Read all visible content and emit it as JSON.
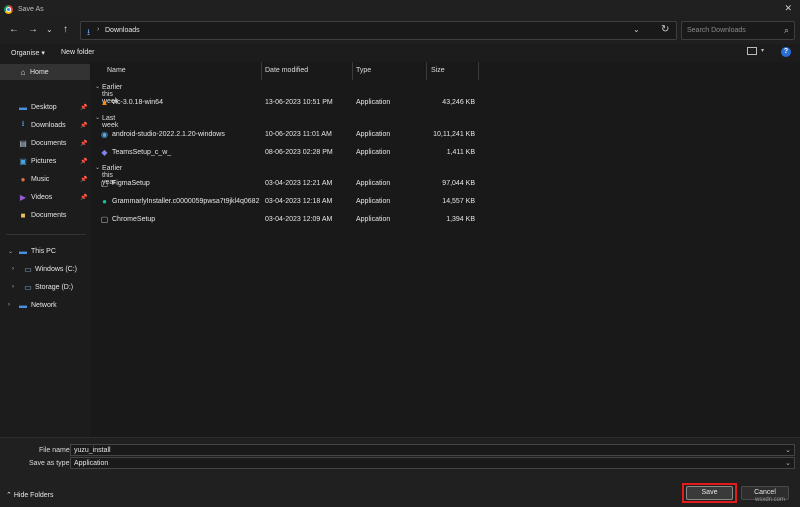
{
  "window": {
    "title": "Save As"
  },
  "address": {
    "path": "Downloads",
    "separator": "›"
  },
  "search": {
    "placeholder": "Search Downloads"
  },
  "toolbar": {
    "organise": "Organise ▾",
    "new_folder": "New folder",
    "help": "?"
  },
  "sidebar": {
    "home": "Home",
    "quick": [
      {
        "label": "Desktop",
        "icon": "desktop-icon"
      },
      {
        "label": "Downloads",
        "icon": "download-icon"
      },
      {
        "label": "Documents",
        "icon": "documents-icon"
      },
      {
        "label": "Pictures",
        "icon": "pictures-icon"
      },
      {
        "label": "Music",
        "icon": "music-icon"
      },
      {
        "label": "Videos",
        "icon": "videos-icon"
      },
      {
        "label": "Documents",
        "icon": "folder-icon"
      }
    ],
    "this_pc": "This PC",
    "drives": [
      "Windows (C:)",
      "Storage (D:)"
    ],
    "network": "Network"
  },
  "columns": {
    "name": "Name",
    "date": "Date modified",
    "type": "Type",
    "size": "Size"
  },
  "groups": [
    {
      "label": "Earlier this week",
      "files": [
        {
          "name": "vlc-3.0.18-win64",
          "date": "13-06-2023 10:51 PM",
          "type": "Application",
          "size": "43,246 KB",
          "icon": "vlc-icon"
        }
      ]
    },
    {
      "label": "Last week",
      "files": [
        {
          "name": "android-studio-2022.2.1.20-windows",
          "date": "10-06-2023 11:01 AM",
          "type": "Application",
          "size": "10,11,241 KB",
          "icon": "android-studio-icon"
        },
        {
          "name": "TeamsSetup_c_w_",
          "date": "08-06-2023 02:28 PM",
          "type": "Application",
          "size": "1,411 KB",
          "icon": "teams-icon"
        }
      ]
    },
    {
      "label": "Earlier this year",
      "files": [
        {
          "name": "FigmaSetup",
          "date": "03-04-2023 12:21 AM",
          "type": "Application",
          "size": "97,044 KB",
          "icon": "figma-icon"
        },
        {
          "name": "GrammarlyInstaller.c0000059pwsa7t9jkl4q0682",
          "date": "03-04-2023 12:18 AM",
          "type": "Application",
          "size": "14,557 KB",
          "icon": "grammarly-icon"
        },
        {
          "name": "ChromeSetup",
          "date": "03-04-2023 12:09 AM",
          "type": "Application",
          "size": "1,394 KB",
          "icon": "chrome-icon"
        }
      ]
    }
  ],
  "footer": {
    "file_name_label": "File name:",
    "file_name_value": "yuzu_install",
    "save_type_label": "Save as type:",
    "save_type_value": "Application",
    "hide_folders": "Hide Folders",
    "save": "Save",
    "cancel": "Cancel"
  },
  "watermark": "wsxdn.com",
  "colors": {
    "accent": "#2a6fd6",
    "highlight": "#e31b1b"
  }
}
